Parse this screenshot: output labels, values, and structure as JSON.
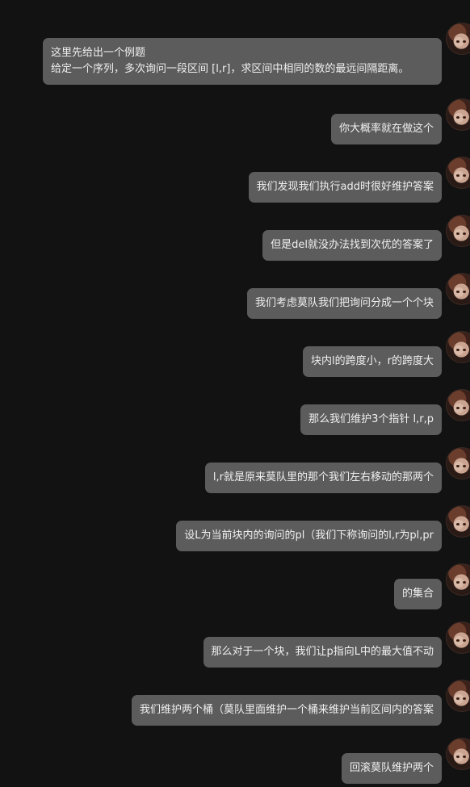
{
  "messages": [
    {
      "lines": [
        "这里先给出一个例题",
        "给定一个序列，多次询问一段区间 [l,r]，求区间中相同的数的最远间隔距离。"
      ]
    },
    {
      "lines": [
        "你大概率就在做这个"
      ]
    },
    {
      "lines": [
        "我们发现我们执行add时很好维护答案"
      ]
    },
    {
      "lines": [
        "但是del就没办法找到次优的答案了"
      ]
    },
    {
      "lines": [
        "我们考虑莫队我们把询问分成一个个块"
      ]
    },
    {
      "lines": [
        "块内l的跨度小，r的跨度大"
      ]
    },
    {
      "lines": [
        "那么我们维护3个指针 l,r,p"
      ]
    },
    {
      "lines": [
        "l,r就是原来莫队里的那个我们左右移动的那两个"
      ]
    },
    {
      "lines": [
        "设L为当前块内的询问的pl（我们下称询问的l,r为pl,pr"
      ]
    },
    {
      "lines": [
        "的集合"
      ]
    },
    {
      "lines": [
        "那么对于一个块，我们让p指向L中的最大值不动"
      ]
    },
    {
      "lines": [
        "我们维护两个桶（莫队里面维护一个桶来维护当前区间内的答案"
      ]
    },
    {
      "lines": [
        "回滚莫队维护两个"
      ]
    }
  ],
  "avatar_icon": "user-avatar-anime-icon",
  "colors": {
    "background": "#121212",
    "bubble": "#5c5c5c",
    "text": "#f0f0f0"
  }
}
